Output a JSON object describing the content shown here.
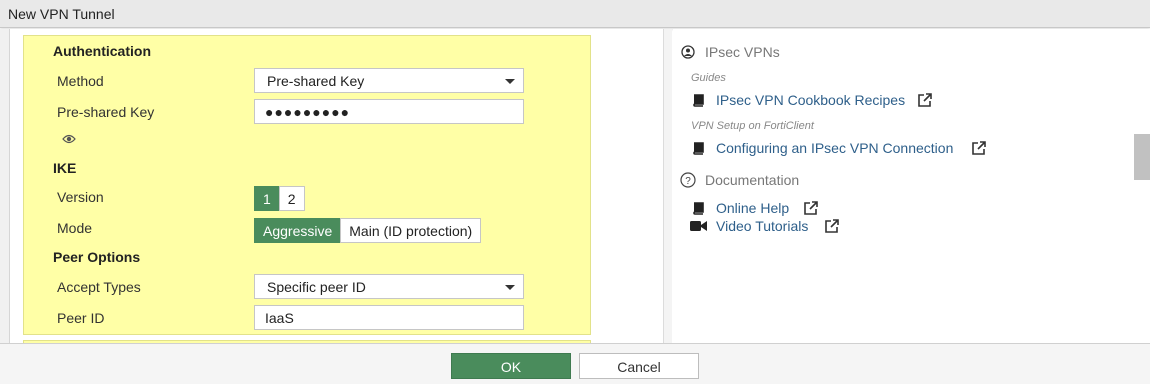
{
  "window": {
    "title": "New VPN Tunnel"
  },
  "form": {
    "authentication": {
      "heading": "Authentication",
      "method_label": "Method",
      "method_value": "Pre-shared Key",
      "psk_label": "Pre-shared Key",
      "psk_value": "●●●●●●●●●"
    },
    "ike": {
      "heading": "IKE",
      "version_label": "Version",
      "versions": [
        "1",
        "2"
      ],
      "version_selected": "1",
      "mode_label": "Mode",
      "modes": [
        "Aggressive",
        "Main (ID protection)"
      ],
      "mode_selected": "Aggressive"
    },
    "peer": {
      "heading": "Peer Options",
      "accept_label": "Accept Types",
      "accept_value": "Specific peer ID",
      "peer_id_label": "Peer ID",
      "peer_id_value": "IaaS"
    }
  },
  "sidebar": {
    "ipsec_heading": "IPsec VPNs",
    "guides_label": "Guides",
    "cookbook_link": "IPsec VPN Cookbook Recipes",
    "forticlient_label": "VPN Setup on FortiClient",
    "forticlient_link": "Configuring an IPsec VPN Connection",
    "documentation_heading": "Documentation",
    "online_help_link": "Online Help",
    "video_link": "Video Tutorials"
  },
  "footer": {
    "ok_label": "OK",
    "cancel_label": "Cancel"
  },
  "colors": {
    "accent": "#4a8c5c",
    "highlight": "#ffffa6",
    "link": "#2e5f8a"
  },
  "icons": [
    "eye-icon",
    "book-icon",
    "external-link-icon",
    "question-circle-icon",
    "video-camera-icon",
    "user-circle-icon"
  ]
}
